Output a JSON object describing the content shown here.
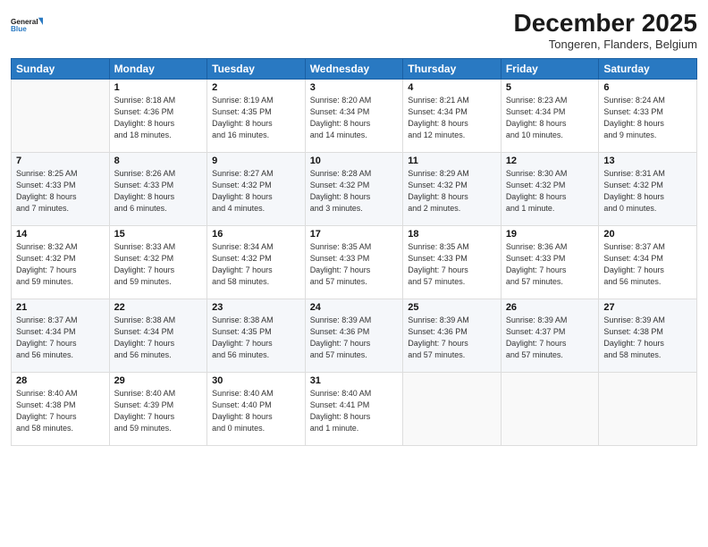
{
  "header": {
    "logo_line1": "General",
    "logo_line2": "Blue",
    "month_title": "December 2025",
    "location": "Tongeren, Flanders, Belgium"
  },
  "weekdays": [
    "Sunday",
    "Monday",
    "Tuesday",
    "Wednesday",
    "Thursday",
    "Friday",
    "Saturday"
  ],
  "weeks": [
    [
      {
        "day": "",
        "info": ""
      },
      {
        "day": "1",
        "info": "Sunrise: 8:18 AM\nSunset: 4:36 PM\nDaylight: 8 hours\nand 18 minutes."
      },
      {
        "day": "2",
        "info": "Sunrise: 8:19 AM\nSunset: 4:35 PM\nDaylight: 8 hours\nand 16 minutes."
      },
      {
        "day": "3",
        "info": "Sunrise: 8:20 AM\nSunset: 4:34 PM\nDaylight: 8 hours\nand 14 minutes."
      },
      {
        "day": "4",
        "info": "Sunrise: 8:21 AM\nSunset: 4:34 PM\nDaylight: 8 hours\nand 12 minutes."
      },
      {
        "day": "5",
        "info": "Sunrise: 8:23 AM\nSunset: 4:34 PM\nDaylight: 8 hours\nand 10 minutes."
      },
      {
        "day": "6",
        "info": "Sunrise: 8:24 AM\nSunset: 4:33 PM\nDaylight: 8 hours\nand 9 minutes."
      }
    ],
    [
      {
        "day": "7",
        "info": "Sunrise: 8:25 AM\nSunset: 4:33 PM\nDaylight: 8 hours\nand 7 minutes."
      },
      {
        "day": "8",
        "info": "Sunrise: 8:26 AM\nSunset: 4:33 PM\nDaylight: 8 hours\nand 6 minutes."
      },
      {
        "day": "9",
        "info": "Sunrise: 8:27 AM\nSunset: 4:32 PM\nDaylight: 8 hours\nand 4 minutes."
      },
      {
        "day": "10",
        "info": "Sunrise: 8:28 AM\nSunset: 4:32 PM\nDaylight: 8 hours\nand 3 minutes."
      },
      {
        "day": "11",
        "info": "Sunrise: 8:29 AM\nSunset: 4:32 PM\nDaylight: 8 hours\nand 2 minutes."
      },
      {
        "day": "12",
        "info": "Sunrise: 8:30 AM\nSunset: 4:32 PM\nDaylight: 8 hours\nand 1 minute."
      },
      {
        "day": "13",
        "info": "Sunrise: 8:31 AM\nSunset: 4:32 PM\nDaylight: 8 hours\nand 0 minutes."
      }
    ],
    [
      {
        "day": "14",
        "info": "Sunrise: 8:32 AM\nSunset: 4:32 PM\nDaylight: 7 hours\nand 59 minutes."
      },
      {
        "day": "15",
        "info": "Sunrise: 8:33 AM\nSunset: 4:32 PM\nDaylight: 7 hours\nand 59 minutes."
      },
      {
        "day": "16",
        "info": "Sunrise: 8:34 AM\nSunset: 4:32 PM\nDaylight: 7 hours\nand 58 minutes."
      },
      {
        "day": "17",
        "info": "Sunrise: 8:35 AM\nSunset: 4:33 PM\nDaylight: 7 hours\nand 57 minutes."
      },
      {
        "day": "18",
        "info": "Sunrise: 8:35 AM\nSunset: 4:33 PM\nDaylight: 7 hours\nand 57 minutes."
      },
      {
        "day": "19",
        "info": "Sunrise: 8:36 AM\nSunset: 4:33 PM\nDaylight: 7 hours\nand 57 minutes."
      },
      {
        "day": "20",
        "info": "Sunrise: 8:37 AM\nSunset: 4:34 PM\nDaylight: 7 hours\nand 56 minutes."
      }
    ],
    [
      {
        "day": "21",
        "info": "Sunrise: 8:37 AM\nSunset: 4:34 PM\nDaylight: 7 hours\nand 56 minutes."
      },
      {
        "day": "22",
        "info": "Sunrise: 8:38 AM\nSunset: 4:34 PM\nDaylight: 7 hours\nand 56 minutes."
      },
      {
        "day": "23",
        "info": "Sunrise: 8:38 AM\nSunset: 4:35 PM\nDaylight: 7 hours\nand 56 minutes."
      },
      {
        "day": "24",
        "info": "Sunrise: 8:39 AM\nSunset: 4:36 PM\nDaylight: 7 hours\nand 57 minutes."
      },
      {
        "day": "25",
        "info": "Sunrise: 8:39 AM\nSunset: 4:36 PM\nDaylight: 7 hours\nand 57 minutes."
      },
      {
        "day": "26",
        "info": "Sunrise: 8:39 AM\nSunset: 4:37 PM\nDaylight: 7 hours\nand 57 minutes."
      },
      {
        "day": "27",
        "info": "Sunrise: 8:39 AM\nSunset: 4:38 PM\nDaylight: 7 hours\nand 58 minutes."
      }
    ],
    [
      {
        "day": "28",
        "info": "Sunrise: 8:40 AM\nSunset: 4:38 PM\nDaylight: 7 hours\nand 58 minutes."
      },
      {
        "day": "29",
        "info": "Sunrise: 8:40 AM\nSunset: 4:39 PM\nDaylight: 7 hours\nand 59 minutes."
      },
      {
        "day": "30",
        "info": "Sunrise: 8:40 AM\nSunset: 4:40 PM\nDaylight: 8 hours\nand 0 minutes."
      },
      {
        "day": "31",
        "info": "Sunrise: 8:40 AM\nSunset: 4:41 PM\nDaylight: 8 hours\nand 1 minute."
      },
      {
        "day": "",
        "info": ""
      },
      {
        "day": "",
        "info": ""
      },
      {
        "day": "",
        "info": ""
      }
    ]
  ]
}
